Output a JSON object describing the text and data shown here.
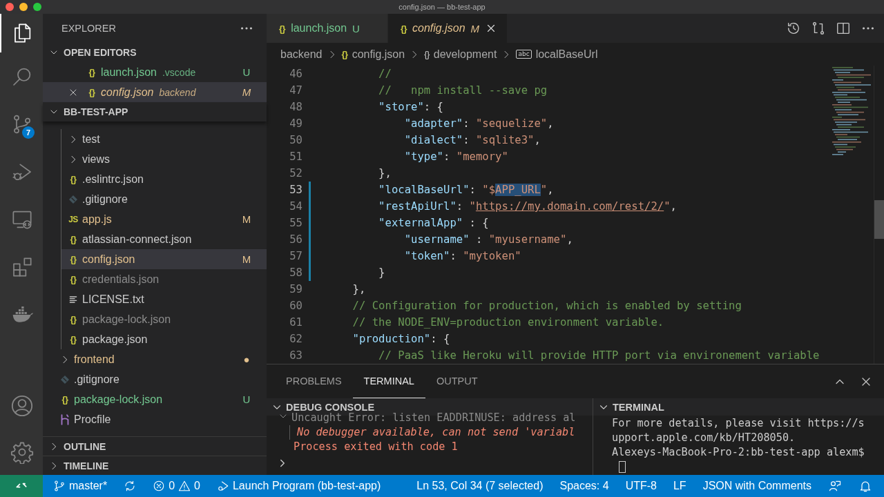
{
  "window": {
    "title": "config.json — bb-test-app"
  },
  "activity_bar": {
    "items": [
      {
        "kind": "explorer",
        "selected": true
      },
      {
        "kind": "search",
        "selected": false
      },
      {
        "kind": "source-control",
        "selected": false,
        "badge": "7"
      },
      {
        "kind": "run-debug",
        "selected": false
      },
      {
        "kind": "remote",
        "selected": false
      },
      {
        "kind": "extensions",
        "selected": false
      },
      {
        "kind": "docker",
        "selected": false
      }
    ],
    "bottom_items": [
      {
        "kind": "account"
      },
      {
        "kind": "settings"
      }
    ]
  },
  "sidebar": {
    "title": "EXPLORER",
    "sections": [
      {
        "kind": "editors",
        "title": "OPEN EDITORS",
        "expanded": true,
        "items": [
          {
            "kind": "json",
            "glyph": "{}",
            "label": "launch.json",
            "folder": ".vscode",
            "status": "U",
            "color": "#73c991",
            "preview": false,
            "selected": false
          },
          {
            "kind": "json",
            "glyph": "{}",
            "label": "config.json",
            "folder": "backend",
            "status": "M",
            "color": "#e2c08d",
            "preview": true,
            "selected": true
          }
        ]
      },
      {
        "kind": "tree",
        "title": "BB-TEST-APP",
        "expanded": true,
        "items": [
          {
            "children": [
              {
                "kind": "folder",
                "label": "test",
                "expanded": false,
                "color": "#cccccc",
                "selected": false
              },
              {
                "kind": "folder",
                "label": "views",
                "expanded": false,
                "color": "#cccccc",
                "selected": false
              },
              {
                "kind": "json",
                "glyph": "{}",
                "label": ".eslintrc.json",
                "color": "#cccccc",
                "selected": false
              },
              {
                "kind": "git",
                "label": ".gitignore",
                "color": "#cccccc",
                "selected": false
              },
              {
                "kind": "js",
                "glyph": "JS",
                "label": "app.js",
                "status": "M",
                "color": "#e2c08d",
                "selected": false
              },
              {
                "kind": "json",
                "glyph": "{}",
                "label": "atlassian-connect.json",
                "color": "#cccccc",
                "selected": false
              },
              {
                "kind": "json",
                "glyph": "{}",
                "label": "config.json",
                "status": "M",
                "color": "#e2c08d",
                "selected": true
              },
              {
                "kind": "json",
                "glyph": "{}",
                "label": "credentials.json",
                "color": "#8c8c8c",
                "selected": false
              },
              {
                "kind": "text",
                "label": "LICENSE.txt",
                "color": "#cccccc",
                "selected": false
              },
              {
                "kind": "json",
                "glyph": "{}",
                "label": "package-lock.json",
                "color": "#8c8c8c",
                "selected": false
              },
              {
                "kind": "json",
                "glyph": "{}",
                "label": "package.json",
                "color": "#cccccc",
                "selected": false
              }
            ]
          },
          {
            "kind": "folder",
            "label": "frontend",
            "expanded": false,
            "status": "●",
            "color": "#e2c08d",
            "selected": false
          },
          {
            "kind": "git",
            "label": ".gitignore",
            "color": "#cccccc",
            "selected": false
          },
          {
            "kind": "json",
            "glyph": "{}",
            "label": "package-lock.json",
            "status": "U",
            "color": "#73c991",
            "selected": false
          },
          {
            "kind": "heroku",
            "label": "Procfile",
            "color": "#cccccc",
            "selected": false
          }
        ]
      },
      {
        "kind": "tree",
        "title": "OUTLINE",
        "expanded": false
      },
      {
        "kind": "tree",
        "title": "TIMELINE",
        "expanded": false
      }
    ]
  },
  "editor": {
    "tabs": [
      {
        "glyph": "{}",
        "label": "launch.json",
        "status": "U",
        "color": "#73c991",
        "preview": false,
        "selected": false
      },
      {
        "glyph": "{}",
        "label": "config.json",
        "status": "M",
        "color": "#e2c08d",
        "preview": true,
        "selected": true
      }
    ],
    "actions": [
      {
        "kind": "history"
      },
      {
        "kind": "compare"
      },
      {
        "kind": "split"
      },
      {
        "kind": "more"
      }
    ],
    "breadcrumbs": [
      {
        "label": "backend",
        "kind": "folder"
      },
      {
        "label": "config.json",
        "kind": "file",
        "glyph": "{}"
      },
      {
        "label": "development",
        "kind": "object",
        "glyph": "{}"
      },
      {
        "label": "localBaseUrl",
        "kind": "string",
        "glyph": "abc"
      }
    ],
    "lines": [
      {
        "number": "46",
        "active": false,
        "modified": false,
        "tokens": [
          {
            "kind": "comment",
            "text": "        //"
          }
        ]
      },
      {
        "number": "47",
        "active": false,
        "modified": false,
        "tokens": [
          {
            "kind": "comment",
            "text": "        //   npm install --save pg"
          }
        ]
      },
      {
        "number": "48",
        "active": false,
        "modified": false,
        "tokens": [
          {
            "kind": "key",
            "text": "        \"store\""
          },
          {
            "kind": "punct",
            "text": ": {"
          }
        ]
      },
      {
        "number": "49",
        "active": false,
        "modified": false,
        "tokens": [
          {
            "kind": "key",
            "text": "            \"adapter\""
          },
          {
            "kind": "punct",
            "text": ": "
          },
          {
            "kind": "string",
            "text": "\"sequelize\""
          },
          {
            "kind": "punct",
            "text": ","
          }
        ]
      },
      {
        "number": "50",
        "active": false,
        "modified": false,
        "tokens": [
          {
            "kind": "key",
            "text": "            \"dialect\""
          },
          {
            "kind": "punct",
            "text": ": "
          },
          {
            "kind": "string",
            "text": "\"sqlite3\""
          },
          {
            "kind": "punct",
            "text": ","
          }
        ]
      },
      {
        "number": "51",
        "active": false,
        "modified": false,
        "tokens": [
          {
            "kind": "key",
            "text": "            \"type\""
          },
          {
            "kind": "punct",
            "text": ": "
          },
          {
            "kind": "string",
            "text": "\"memory\""
          }
        ]
      },
      {
        "number": "52",
        "active": false,
        "modified": false,
        "tokens": [
          {
            "kind": "punct",
            "text": "        },"
          }
        ]
      },
      {
        "number": "53",
        "active": true,
        "modified": true,
        "tokens": [
          {
            "kind": "key",
            "text": "        \"localBaseUrl\""
          },
          {
            "kind": "punct",
            "text": ": "
          },
          {
            "kind": "string",
            "text": "\"$"
          },
          {
            "kind": "selection",
            "text": "APP_URL"
          },
          {
            "kind": "string",
            "text": "\""
          },
          {
            "kind": "punct",
            "text": ","
          }
        ]
      },
      {
        "number": "54",
        "active": false,
        "modified": true,
        "tokens": [
          {
            "kind": "key",
            "text": "        \"restApiUrl\""
          },
          {
            "kind": "punct",
            "text": ": "
          },
          {
            "kind": "string",
            "text": "\""
          },
          {
            "kind": "link",
            "text": "https://my.domain.com/rest/2/"
          },
          {
            "kind": "string",
            "text": "\""
          },
          {
            "kind": "punct",
            "text": ","
          }
        ]
      },
      {
        "number": "55",
        "active": false,
        "modified": true,
        "tokens": [
          {
            "kind": "key",
            "text": "        \"externalApp\""
          },
          {
            "kind": "punct",
            "text": " : {"
          }
        ]
      },
      {
        "number": "56",
        "active": false,
        "modified": true,
        "tokens": [
          {
            "kind": "key",
            "text": "            \"username\""
          },
          {
            "kind": "punct",
            "text": " : "
          },
          {
            "kind": "string",
            "text": "\"myusername\""
          },
          {
            "kind": "punct",
            "text": ","
          }
        ]
      },
      {
        "number": "57",
        "active": false,
        "modified": true,
        "tokens": [
          {
            "kind": "key",
            "text": "            \"token\""
          },
          {
            "kind": "punct",
            "text": ": "
          },
          {
            "kind": "string",
            "text": "\"mytoken\""
          }
        ]
      },
      {
        "number": "58",
        "active": false,
        "modified": true,
        "tokens": [
          {
            "kind": "punct",
            "text": "        }"
          }
        ]
      },
      {
        "number": "59",
        "active": false,
        "modified": false,
        "tokens": [
          {
            "kind": "punct",
            "text": "    },"
          }
        ]
      },
      {
        "number": "60",
        "active": false,
        "modified": false,
        "tokens": [
          {
            "kind": "comment",
            "text": "    // Configuration for production, which is enabled by setting"
          }
        ]
      },
      {
        "number": "61",
        "active": false,
        "modified": false,
        "tokens": [
          {
            "kind": "comment",
            "text": "    // the NODE_ENV=production environment variable."
          }
        ]
      },
      {
        "number": "62",
        "active": false,
        "modified": false,
        "tokens": [
          {
            "kind": "key",
            "text": "    \"production\""
          },
          {
            "kind": "punct",
            "text": ": {"
          }
        ]
      },
      {
        "number": "63",
        "active": false,
        "modified": false,
        "tokens": [
          {
            "kind": "comment",
            "text": "        // PaaS like Heroku will provide HTTP port via environement variable"
          }
        ]
      }
    ]
  },
  "panel": {
    "tabs": [
      {
        "label": "PROBLEMS",
        "selected": false
      },
      {
        "label": "TERMINAL",
        "selected": true
      },
      {
        "label": "OUTPUT",
        "selected": false
      }
    ],
    "debug_console": {
      "title": "DEBUG CONSOLE",
      "expanded": true,
      "lines": [
        {
          "kind": "group",
          "text": "Uncaught Error: listen EADDRINUSE: address al"
        },
        {
          "kind": "italic-error",
          "text": "No debugger available, can not send 'variabl"
        },
        {
          "kind": "error",
          "text": "Process exited with code 1"
        }
      ]
    },
    "terminal": {
      "title": "TERMINAL",
      "expanded": true,
      "lines": [
        "For more details, please visit https://s",
        "upport.apple.com/kb/HT208050.",
        "Alexeys-MacBook-Pro-2:bb-test-app alexm$"
      ]
    }
  },
  "status_bar": {
    "left": [
      {
        "kind": "remote"
      },
      {
        "kind": "branch",
        "text": "master*"
      },
      {
        "kind": "sync"
      },
      {
        "kind": "problems",
        "errors": "0",
        "warnings": "0"
      },
      {
        "kind": "launch",
        "text": "Launch Program (bb-test-app)"
      }
    ],
    "right": [
      {
        "kind": "text",
        "text": "Ln 53, Col 34 (7 selected)"
      },
      {
        "kind": "text",
        "text": "Spaces: 4"
      },
      {
        "kind": "text",
        "text": "UTF-8"
      },
      {
        "kind": "text",
        "text": "LF"
      },
      {
        "kind": "text",
        "text": "JSON with Comments"
      },
      {
        "kind": "feedback"
      },
      {
        "kind": "bell"
      }
    ]
  }
}
